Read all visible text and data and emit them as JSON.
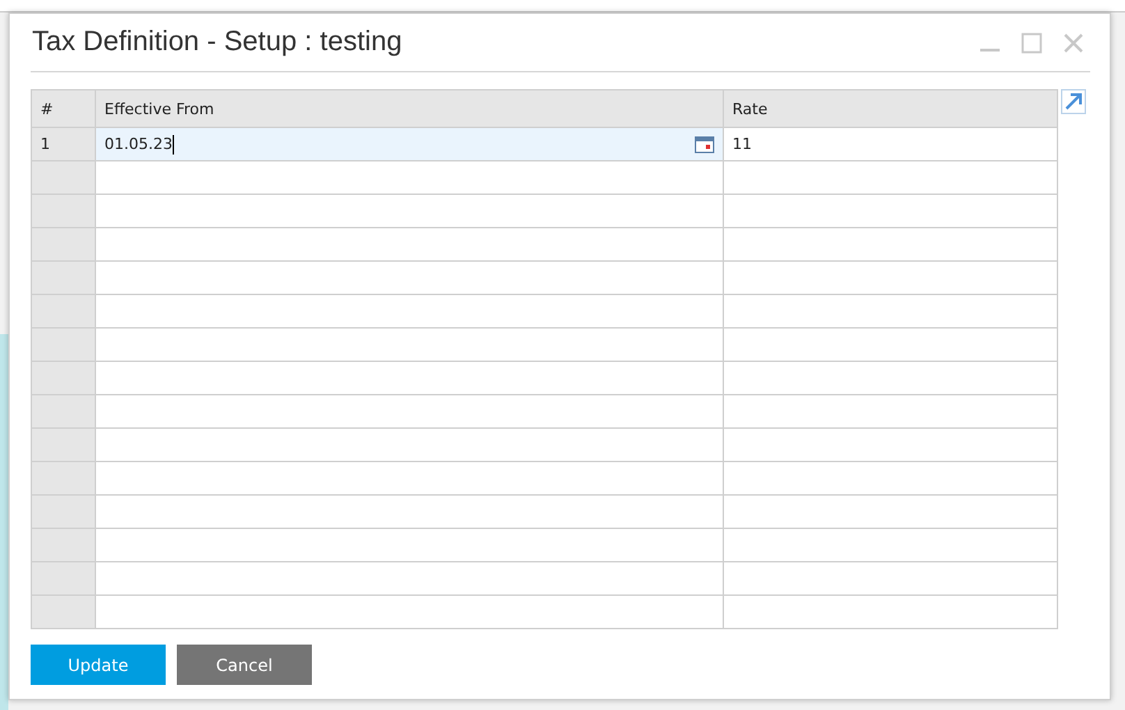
{
  "window": {
    "title": "Tax Definition - Setup : testing"
  },
  "table": {
    "columns": [
      "#",
      "Effective From",
      "Rate"
    ],
    "rows": [
      {
        "number": "1",
        "effective_from": "01.05.23",
        "rate": "11",
        "editing": true
      }
    ]
  },
  "buttons": [
    {
      "label": "Update",
      "kind": "primary"
    },
    {
      "label": "Cancel",
      "kind": "secondary"
    }
  ]
}
